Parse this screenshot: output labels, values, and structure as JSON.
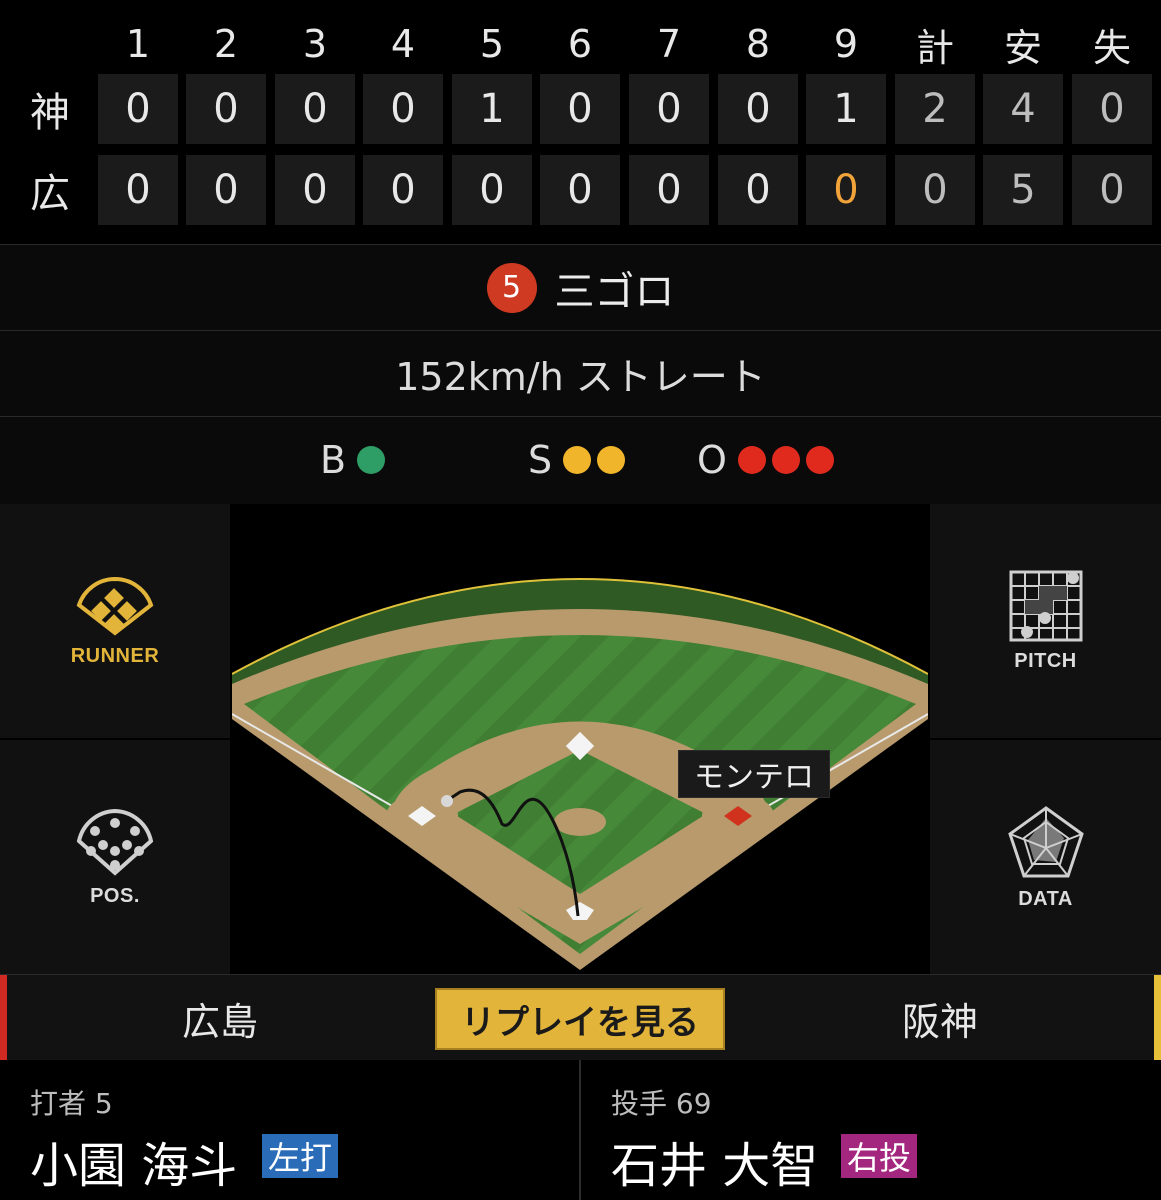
{
  "scoreboard": {
    "headers": [
      "1",
      "2",
      "3",
      "4",
      "5",
      "6",
      "7",
      "8",
      "9",
      "計",
      "安",
      "失"
    ],
    "teams": [
      {
        "abbr": "神",
        "scores": [
          "0",
          "0",
          "0",
          "0",
          "1",
          "0",
          "0",
          "0",
          "1",
          "2",
          "4",
          "0"
        ]
      },
      {
        "abbr": "広",
        "scores": [
          "0",
          "0",
          "0",
          "0",
          "0",
          "0",
          "0",
          "0",
          "0",
          "0",
          "5",
          "0"
        ],
        "highlight_index": 8
      }
    ]
  },
  "play": {
    "fielder_number": "5",
    "result": "三ゴロ",
    "pitch": "152km/h ストレート"
  },
  "count": {
    "ball_letter": "B",
    "balls": 1,
    "strike_letter": "S",
    "strikes": 2,
    "out_letter": "O",
    "outs": 3
  },
  "nav": {
    "runner": "RUNNER",
    "pitch": "PITCH",
    "pos": "POS.",
    "data": "DATA"
  },
  "field": {
    "runner_name": "モンテロ"
  },
  "teambar": {
    "left_team": "広島",
    "replay": "リプレイを見る",
    "right_team": "阪神"
  },
  "batter": {
    "role": "打者 5",
    "name": "小園 海斗",
    "hand": "左打"
  },
  "pitcher": {
    "role": "投手 69",
    "name": "石井 大智",
    "hand": "右投"
  },
  "colors": {
    "accent_gold": "#e2b43a",
    "batter_badge": "#2a6cb8",
    "pitcher_badge": "#a3277e",
    "home_edge": "#d12a22",
    "away_edge": "#e8c13a"
  }
}
